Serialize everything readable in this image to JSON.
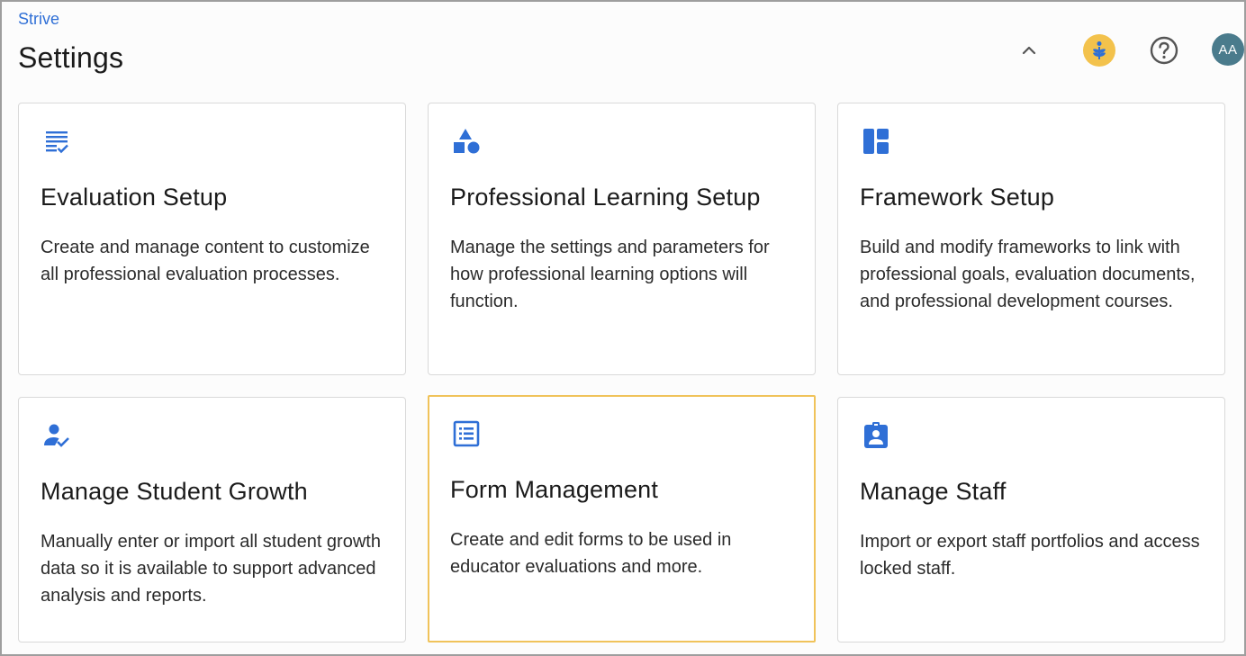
{
  "header": {
    "breadcrumb": "Strive",
    "title": "Settings",
    "avatar_initials": "AA",
    "icons": {
      "collapse": "chevron-up-icon",
      "logo": "wheat-logo-icon",
      "help": "help-circle-icon"
    }
  },
  "colors": {
    "accent": "#2f6fd6",
    "selected_border": "#f0c35a",
    "avatar_bg": "#4a7b8c",
    "logo_bg": "#f3c24c"
  },
  "cards": [
    {
      "icon": "checklist-icon",
      "title": "Evaluation Setup",
      "description": "Create and manage content to customize all professional evaluation processes."
    },
    {
      "icon": "shapes-icon",
      "title": "Professional Learning Setup",
      "description": "Manage the settings and parameters for how professional learning options will function."
    },
    {
      "icon": "dashboard-layout-icon",
      "title": "Framework Setup",
      "description": "Build and modify frameworks to link with professional goals, evaluation documents, and professional development courses."
    },
    {
      "icon": "person-check-icon",
      "title": "Manage Student Growth",
      "description": "Manually enter or import all student growth data so it is available to support advanced analysis and reports."
    },
    {
      "icon": "list-form-icon",
      "title": "Form Management",
      "description": "Create and edit forms to be used in educator evaluations and more.",
      "selected": true
    },
    {
      "icon": "id-badge-icon",
      "title": "Manage Staff",
      "description": "Import or export staff portfolios and access locked staff."
    }
  ]
}
